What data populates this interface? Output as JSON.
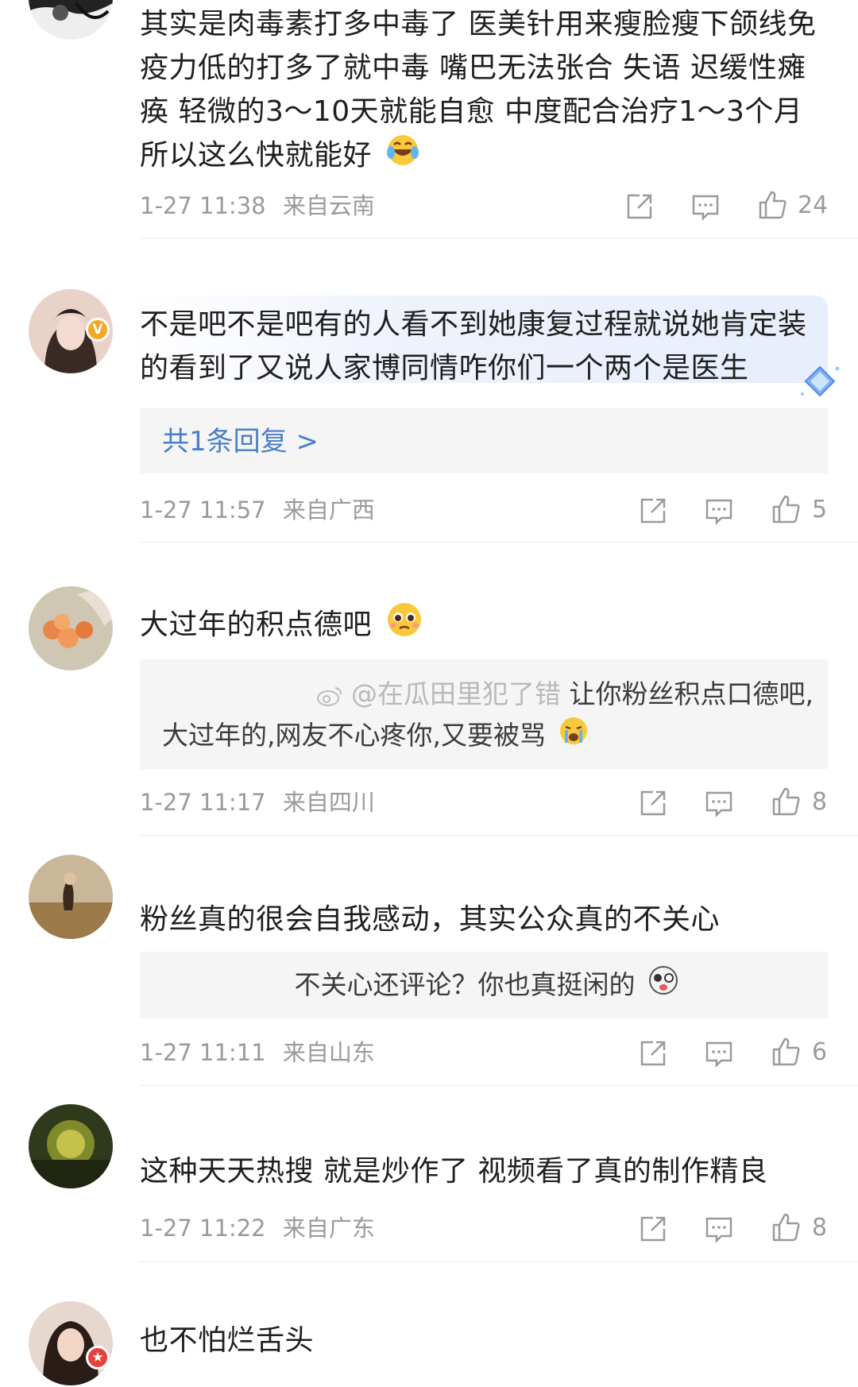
{
  "comments": [
    {
      "text": "其实是肉毒素打多中毒了 医美针用来瘦脸瘦下颌线免疫力低的打多了就中毒 嘴巴无法张合 失语 迟缓性瘫痪 轻微的3～10天就能自愈 中度配合治疗1～3个月 所以这么快就能好",
      "emoji": "laugh-cry-emoji",
      "date": "1-27 11:38",
      "location": "来自云南",
      "likes": "24"
    },
    {
      "text": "不是吧不是吧有的人看不到她康复过程就说她肯定装的看到了又说人家博同情咋你们一个两个是医生",
      "badge": "V",
      "reply_count_link": "共1条回复 >",
      "date": "1-27 11:57",
      "location": "来自广西",
      "likes": "5"
    },
    {
      "text": "大过年的积点德吧",
      "emoji": "pleading-emoji",
      "quote_watermark": "@在瓜田里犯了错",
      "quote_text_line1": "让你粉丝积点口德吧,",
      "quote_text_line2": "大过年的,网友不心疼你,又要被骂",
      "quote_emoji": "crying-emoji",
      "date": "1-27 11:17",
      "location": "来自四川",
      "likes": "8"
    },
    {
      "text": "粉丝真的很会自我感动，其实公众真的不关心",
      "quote_text": "不关心还评论？你也真挺闲的",
      "quote_emoji": "dizzy-face-emoji",
      "date": "1-27 11:11",
      "location": "来自山东",
      "likes": "6"
    },
    {
      "text": "这种天天热搜 就是炒作了 视频看了真的制作精良",
      "date": "1-27 11:22",
      "location": "来自广东",
      "likes": "8"
    },
    {
      "text": "也不怕烂舌头",
      "badge": "★"
    }
  ],
  "colors": {
    "link": "#4a7fc7",
    "meta": "#9a9a9a",
    "text": "#1f1f1f",
    "reply_bg": "#f5f5f5",
    "vip_badge": "#f5a623",
    "red_badge": "#e8413a"
  }
}
